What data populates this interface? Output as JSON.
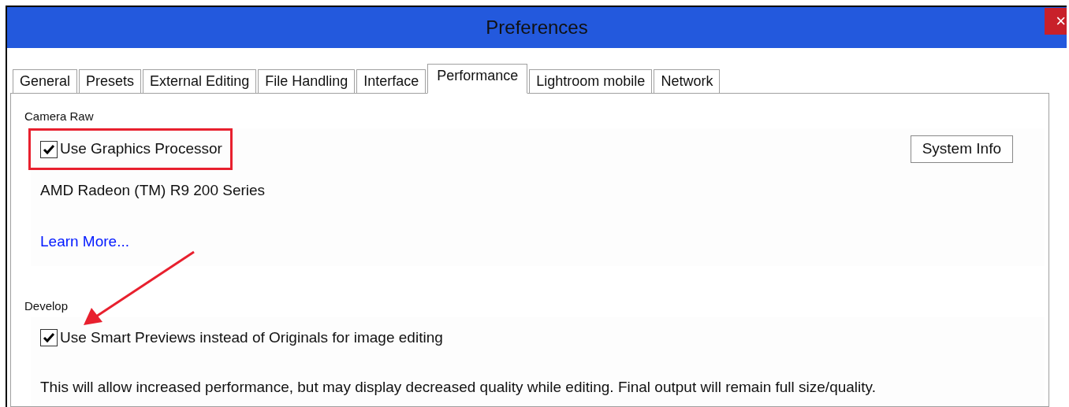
{
  "window": {
    "title": "Preferences",
    "close": "×"
  },
  "tabs": [
    {
      "label": "General",
      "selected": false
    },
    {
      "label": "Presets",
      "selected": false
    },
    {
      "label": "External Editing",
      "selected": false
    },
    {
      "label": "File Handling",
      "selected": false
    },
    {
      "label": "Interface",
      "selected": false
    },
    {
      "label": "Performance",
      "selected": true
    },
    {
      "label": "Lightroom mobile",
      "selected": false
    },
    {
      "label": "Network",
      "selected": false
    }
  ],
  "camera_raw": {
    "heading": "Camera Raw",
    "checkbox": {
      "label": "Use Graphics Processor",
      "checked": true,
      "highlighted": true
    },
    "system_info_button": "System Info",
    "gpu_name": "AMD Radeon (TM) R9 200 Series",
    "link": "Learn More..."
  },
  "develop": {
    "heading": "Develop",
    "checkbox": {
      "label": "Use Smart Previews instead of Originals for image editing",
      "checked": true,
      "highlighted": false
    },
    "description": "This will allow increased performance, but may display decreased quality while editing. Final output will remain full size/quality."
  }
}
